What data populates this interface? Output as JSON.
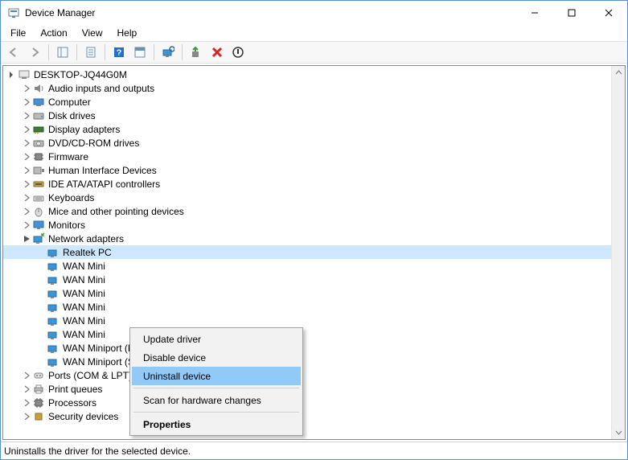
{
  "window": {
    "title": "Device Manager"
  },
  "menu": {
    "file": "File",
    "action": "Action",
    "view": "View",
    "help": "Help"
  },
  "tree": {
    "root": "DESKTOP-JQ44G0M",
    "cat_audio": "Audio inputs and outputs",
    "cat_computer": "Computer",
    "cat_disk": "Disk drives",
    "cat_display": "Display adapters",
    "cat_dvd": "DVD/CD-ROM drives",
    "cat_firmware": "Firmware",
    "cat_hid": "Human Interface Devices",
    "cat_ide": "IDE ATA/ATAPI controllers",
    "cat_kb": "Keyboards",
    "cat_mice": "Mice and other pointing devices",
    "cat_monitors": "Monitors",
    "cat_network": "Network adapters",
    "net_realtek": "Realtek PC",
    "net_wan1": "WAN Mini",
    "net_wan2": "WAN Mini",
    "net_wan3": "WAN Mini",
    "net_wan4": "WAN Mini",
    "net_wan5": "WAN Mini",
    "net_wan6": "WAN Mini",
    "net_wan7": "WAN Miniport (PPTP)",
    "net_wan8": "WAN Miniport (SSTP)",
    "cat_ports": "Ports (COM & LPT)",
    "cat_printq": "Print queues",
    "cat_proc": "Processors",
    "cat_sec": "Security devices"
  },
  "context_menu": {
    "update": "Update driver",
    "disable": "Disable device",
    "uninstall": "Uninstall device",
    "scan": "Scan for hardware changes",
    "properties": "Properties"
  },
  "statusbar": {
    "text": "Uninstalls the driver for the selected device."
  }
}
